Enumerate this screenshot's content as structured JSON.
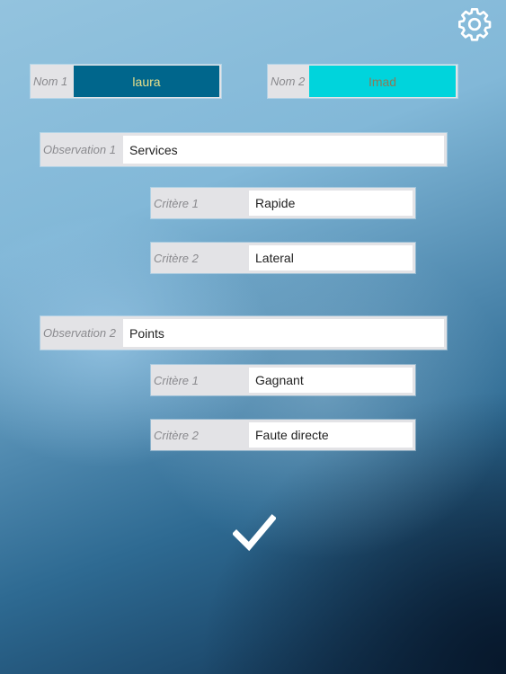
{
  "settings_icon": "gear-icon",
  "names": [
    {
      "label": "Nom 1",
      "value": "laura",
      "bg": "#00668c",
      "color": "#e8e08a"
    },
    {
      "label": "Nom 2",
      "value": "Imad",
      "bg": "#00d4dc",
      "color": "#8a7a5a"
    }
  ],
  "observations": [
    {
      "label": "Observation 1",
      "value": "Services",
      "criteria": [
        {
          "label": "Critère 1",
          "value": "Rapide"
        },
        {
          "label": "Critère 2",
          "value": "Lateral"
        }
      ]
    },
    {
      "label": "Observation 2",
      "value": "Points",
      "criteria": [
        {
          "label": "Critère 1",
          "value": "Gagnant"
        },
        {
          "label": "Critère 2",
          "value": "Faute directe"
        }
      ]
    }
  ],
  "confirm_icon": "checkmark-icon"
}
